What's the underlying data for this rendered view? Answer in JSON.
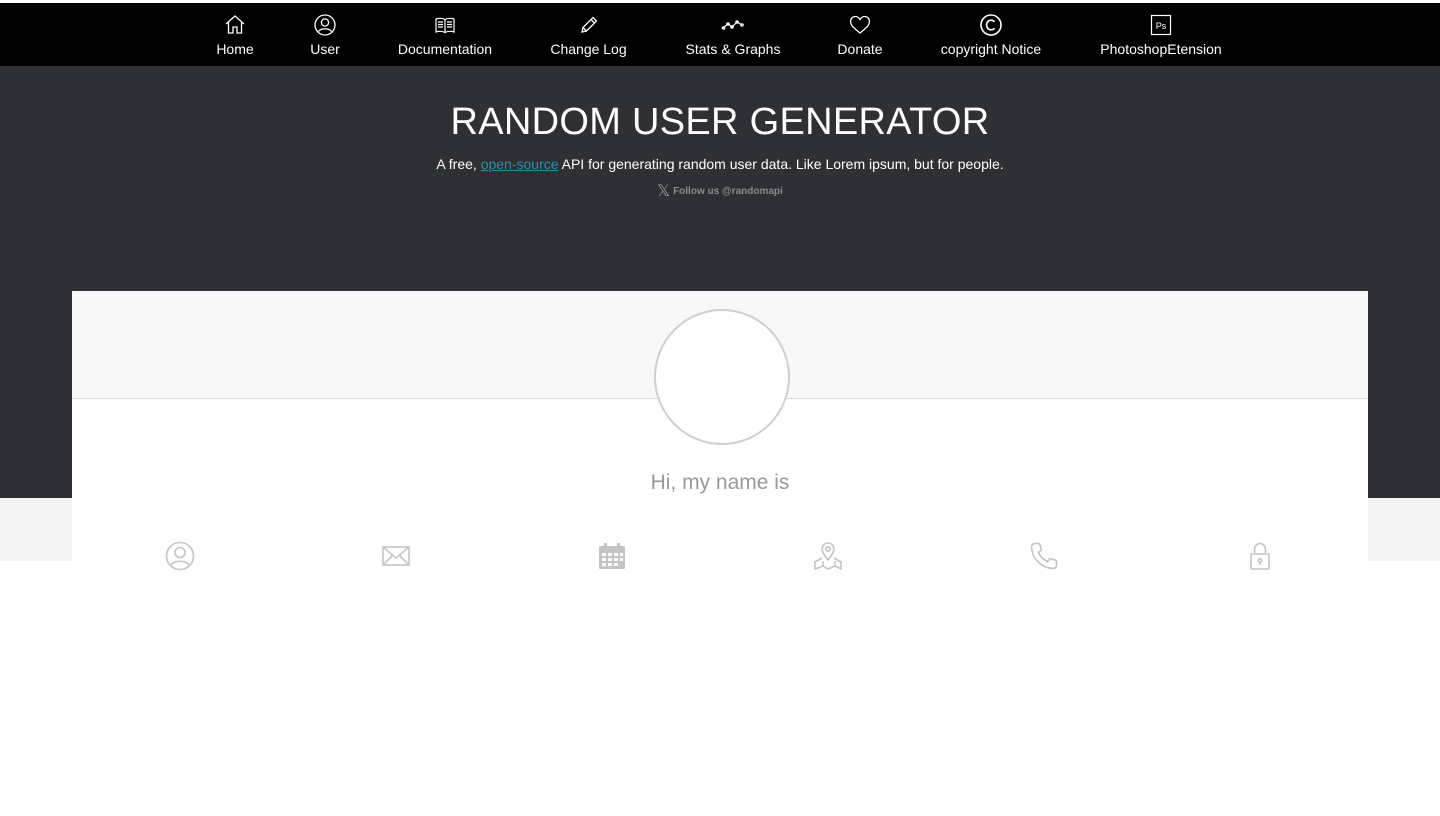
{
  "nav": {
    "items": [
      {
        "label": "Home",
        "icon": "home-icon"
      },
      {
        "label": "User",
        "icon": "user-icon"
      },
      {
        "label": "Documentation",
        "icon": "book-icon"
      },
      {
        "label": "Change Log",
        "icon": "pencil-icon"
      },
      {
        "label": "Stats & Graphs",
        "icon": "graph-icon"
      },
      {
        "label": "Donate",
        "icon": "heart-icon"
      },
      {
        "label": "copyright Notice",
        "icon": "copyright-icon"
      },
      {
        "label": "PhotoshopEtension",
        "icon": "photoshop-icon"
      }
    ],
    "photoshop_icon_text": "Ps",
    "copyright_symbol": "©"
  },
  "hero": {
    "title": "RANDOM USER GENERATOR",
    "subtitle_prefix": "A free, ",
    "subtitle_link": "open-source",
    "subtitle_suffix": " API for generating random user data. Like Lorem ipsum, but for people.",
    "follow_icon": "𝕏",
    "follow_text": "Follow us @randomapi"
  },
  "card": {
    "greeting": "Hi, my name is",
    "detail_icons": [
      "user-icon",
      "envelope-icon",
      "calendar-icon",
      "map-icon",
      "phone-icon",
      "lock-icon"
    ]
  },
  "colors": {
    "nav_bg": "#000000",
    "hero_bg": "#2e3035",
    "link": "#2f8fa8",
    "icon_gray": "#c4c4c4",
    "greeting": "#999999"
  }
}
